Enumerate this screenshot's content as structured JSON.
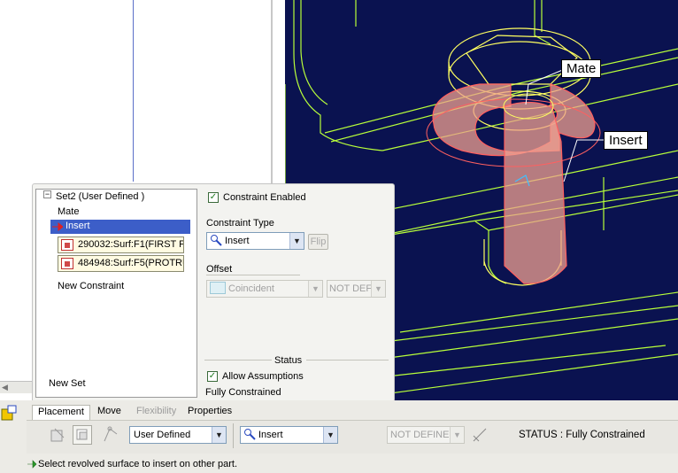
{
  "viewport": {
    "callouts": {
      "mate": "Mate",
      "insert": "Insert"
    }
  },
  "set_list": {
    "set_header": "Set2 (User Defined )",
    "items": [
      "Mate",
      "Insert"
    ],
    "refs": [
      "290032:Surf:F1(FIRST F",
      "484948:Surf:F5(PROTRU"
    ],
    "new_constraint": "New Constraint",
    "new_set": "New Set"
  },
  "constraint": {
    "enabled_label": "Constraint Enabled",
    "enabled": true,
    "type_label": "Constraint Type",
    "type_value": "Insert",
    "flip_label": "Flip",
    "offset_label": "Offset",
    "offset_value": "Coincident",
    "offset_ref": "NOT DEF"
  },
  "status": {
    "title": "Status",
    "allow_assumptions_label": "Allow Assumptions",
    "allow_assumptions": true,
    "state": "Fully Constrained"
  },
  "dashboard": {
    "tabs": [
      "Placement",
      "Move",
      "Flexibility",
      "Properties"
    ],
    "active_tab": "Placement",
    "constraint_set_value": "User Defined",
    "constraint_type_value": "Insert",
    "offset_value": "NOT DEFINE",
    "status_text": "STATUS : Fully Constrained"
  },
  "message": "Select revolved surface to insert on other part.",
  "colors": {
    "viewport_bg": "#0a1250",
    "edge_green": "#b8ff3a",
    "edge_yellow": "#ffff60",
    "highlight_fill": "#f0a090",
    "selection_blue": "#3c5ec8"
  }
}
